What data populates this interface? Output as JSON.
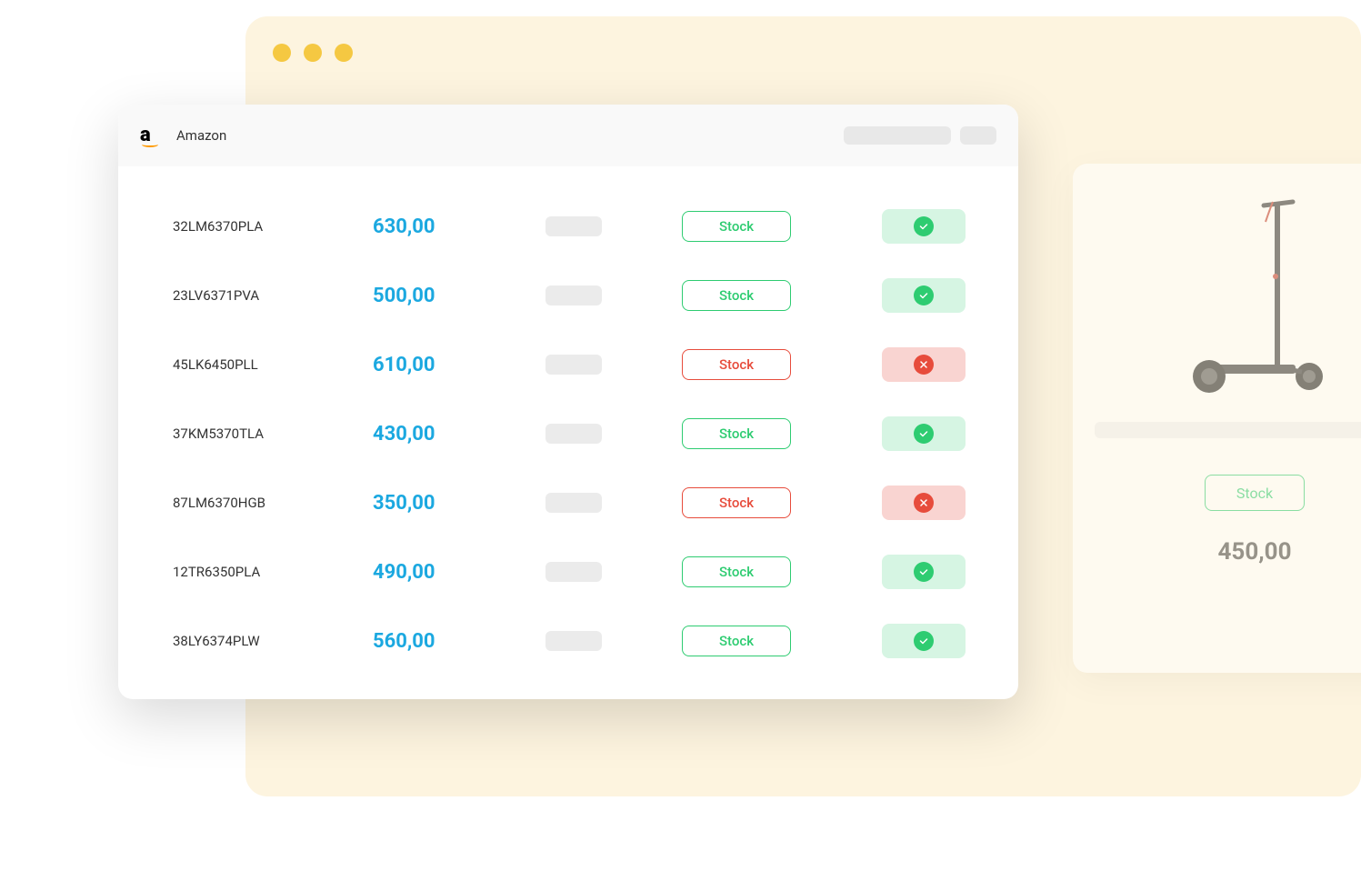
{
  "header": {
    "title": "Amazon"
  },
  "rows": [
    {
      "sku": "32LM6370PLA",
      "price": "630,00",
      "stock_label": "Stock",
      "in_stock": true
    },
    {
      "sku": "23LV6371PVA",
      "price": "500,00",
      "stock_label": "Stock",
      "in_stock": true
    },
    {
      "sku": "45LK6450PLL",
      "price": "610,00",
      "stock_label": "Stock",
      "in_stock": false
    },
    {
      "sku": "37KM5370TLA",
      "price": "430,00",
      "stock_label": "Stock",
      "in_stock": true
    },
    {
      "sku": "87LM6370HGB",
      "price": "350,00",
      "stock_label": "Stock",
      "in_stock": false
    },
    {
      "sku": "12TR6350PLA",
      "price": "490,00",
      "stock_label": "Stock",
      "in_stock": true
    },
    {
      "sku": "38LY6374PLW",
      "price": "560,00",
      "stock_label": "Stock",
      "in_stock": true
    }
  ],
  "side_card": {
    "stock_label": "Stock",
    "price": "450,00"
  }
}
